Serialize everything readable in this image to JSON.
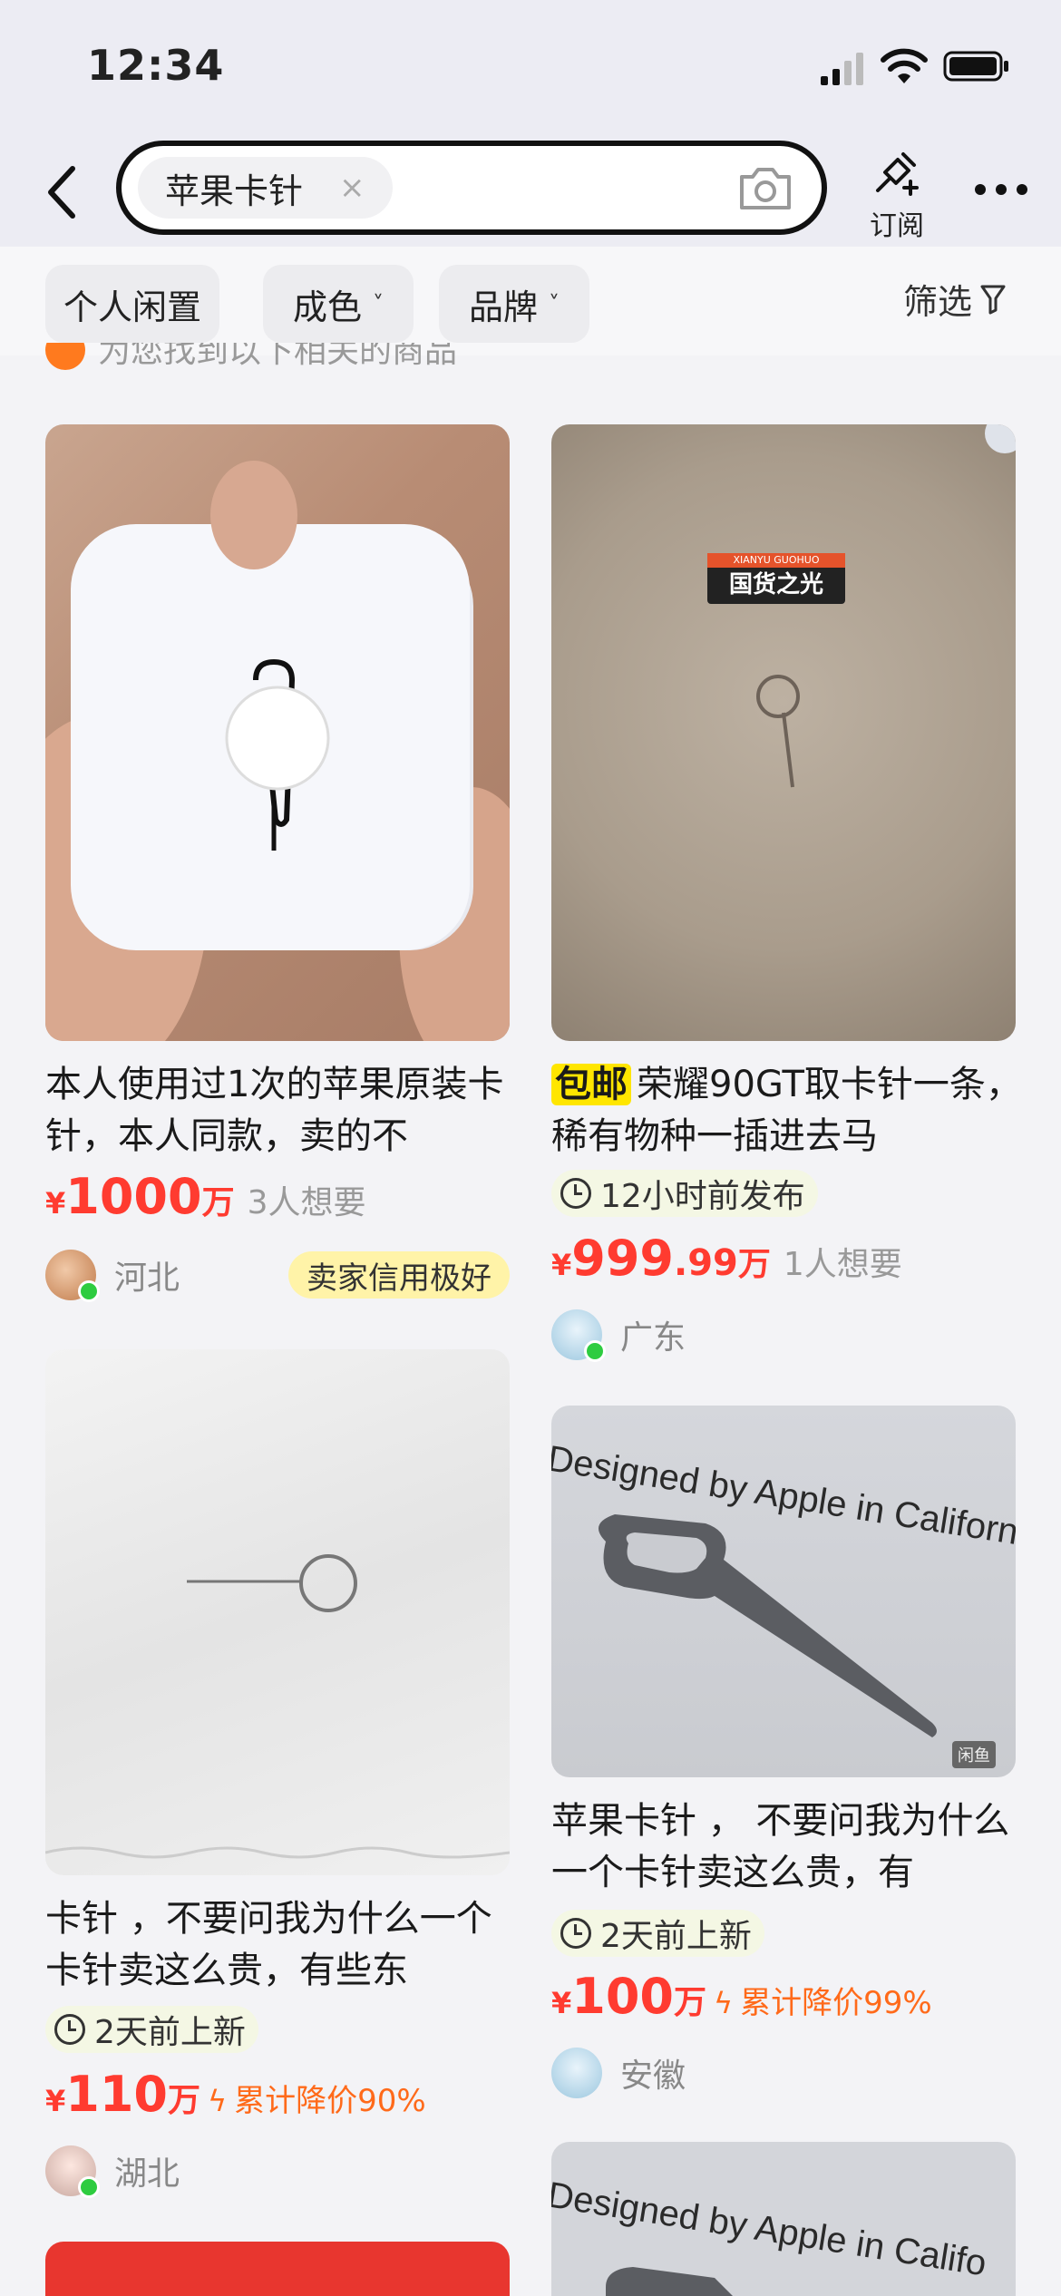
{
  "status_bar": {
    "time": "12:34"
  },
  "header": {
    "search_chip": "苹果卡针",
    "chip_clear": "×",
    "subscribe_label": "订阅"
  },
  "filters": {
    "items": [
      {
        "label": "个人闲置"
      },
      {
        "label": "成色",
        "chevron": "˅"
      },
      {
        "label": "品牌",
        "chevron": "˅"
      }
    ],
    "screen_label": "筛选"
  },
  "peek_text": "为您找到以下相关的商品",
  "products": [
    {
      "title": "本人使用过1次的苹果原装卡针，本人同款，卖的不",
      "price_yen": "¥",
      "price_int": "1000",
      "price_unit": "万",
      "want": "3人想要",
      "location": "河北",
      "credit": "卖家信用极好"
    },
    {
      "post_tag": "包邮",
      "title": "荣耀90GT取卡针一条，稀有物种一插进去马",
      "img_badge": "国货之光",
      "img_badge_small": "XIANYU GUOHUO",
      "time_tag": "12小时前发布",
      "price_yen": "¥",
      "price_int": "999",
      "price_dec": ".99",
      "price_unit": "万",
      "want": "1人想要",
      "location": "广东"
    },
    {
      "title": "卡针 ，不要问我为什么一个卡针卖这么贵，有些东",
      "time_tag": "2天前上新",
      "price_yen": "¥",
      "price_int": "110",
      "price_unit": "万",
      "drop_icon": "ϟ",
      "drop": "累计降价90%",
      "location": "湖北"
    },
    {
      "title": "苹果卡针 ， 不要问我为什么一个卡针卖这么贵，有",
      "img_text": "Designed by Apple in California",
      "img_mark": "闲鱼",
      "time_tag": "2天前上新",
      "price_yen": "¥",
      "price_int": "100",
      "price_unit": "万",
      "drop_icon": "ϟ",
      "drop": "累计降价99%",
      "location": "安徽"
    },
    {
      "img_text": "Designed by Apple in Califo"
    }
  ]
}
